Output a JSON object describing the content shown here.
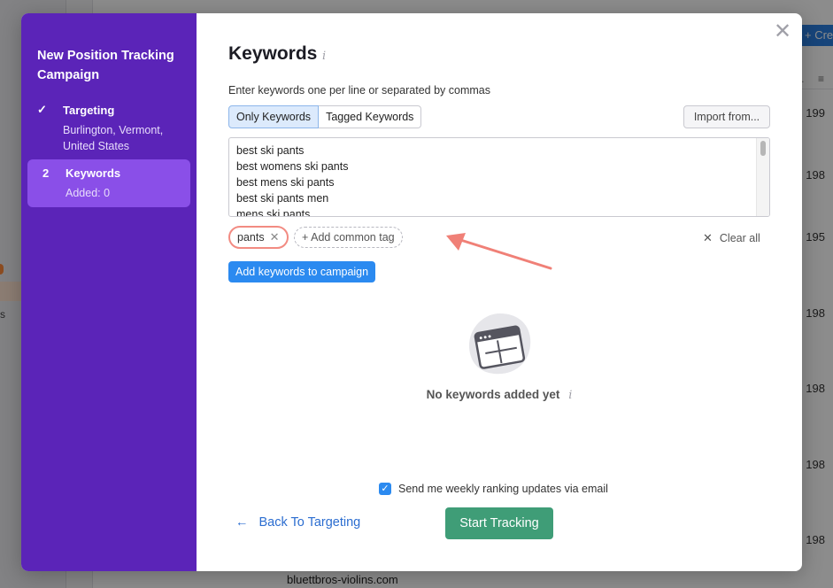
{
  "background": {
    "create_button_label": "+ Cre",
    "row_numbers": [
      "199",
      "198",
      "195",
      "198",
      "198",
      "198",
      "198"
    ],
    "footer_text": "bluettbros-violins.com"
  },
  "sidebar": {
    "title": "New Position Tracking Campaign",
    "steps": [
      {
        "marker": "✓",
        "label": "Targeting",
        "sub": "Burlington, Vermont, United States"
      },
      {
        "marker": "2",
        "label": "Keywords",
        "sub": "Added: 0"
      }
    ]
  },
  "main": {
    "title": "Keywords",
    "info_glyph": "i",
    "instruction": "Enter keywords one per line or separated by commas",
    "toggle": {
      "only_label": "Only Keywords",
      "tagged_label": "Tagged Keywords"
    },
    "import_label": "Import from...",
    "keywords": [
      "best ski pants",
      "best womens ski pants",
      "best mens ski pants",
      "best ski pants men",
      "mens ski pants"
    ],
    "tag": {
      "label": "pants"
    },
    "add_tag_label": "Add common tag",
    "clear_all_label": "Clear all",
    "add_keywords_label": "Add keywords to campaign",
    "empty_text": "No keywords added yet",
    "email_label": "Send me weekly ranking updates via email",
    "email_checked": true,
    "back_label": "Back To Targeting",
    "start_label": "Start Tracking"
  },
  "colors": {
    "sidebar_bg": "#5b24b8",
    "active_step_bg": "#8a4fe8",
    "primary_blue": "#2b8af0",
    "start_green": "#3f9d77",
    "highlight_red": "#f28b82"
  }
}
